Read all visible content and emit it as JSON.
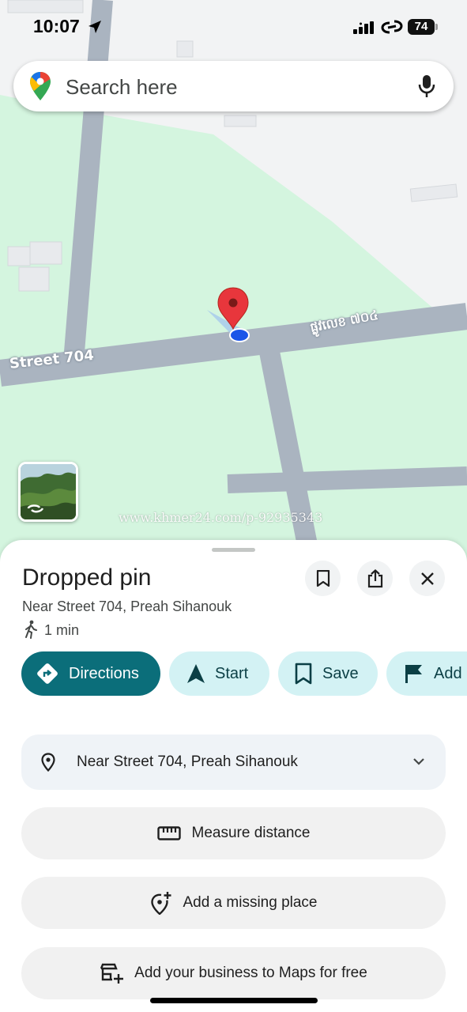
{
  "status_bar": {
    "time": "10:07",
    "battery": "74"
  },
  "search": {
    "placeholder": "Search here"
  },
  "map": {
    "street_label_1": "Street 704",
    "street_label_2": "ផ្លូវលេខ ៧០៤",
    "watermark": "www.khmer24.com/p-92935343"
  },
  "place": {
    "title": "Dropped pin",
    "subtitle": "Near Street 704, Preah Sihanouk",
    "walk_time": "1 min"
  },
  "actions": {
    "directions": "Directions",
    "start": "Start",
    "save": "Save",
    "add": "Add"
  },
  "address_row": {
    "text": "Near Street 704, Preah Sihanouk"
  },
  "buttons": {
    "measure": "Measure distance",
    "missing_place": "Add a missing place",
    "business": "Add your business to Maps for free"
  },
  "colors": {
    "map_green": "#d4f5df",
    "road": "#aab4c0",
    "primary": "#0b6e7a",
    "chip": "#d3f2f4"
  }
}
